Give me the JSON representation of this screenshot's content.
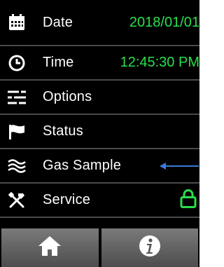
{
  "menu": {
    "date": {
      "label": "Date",
      "value": "2018/01/01",
      "icon": "calendar-icon"
    },
    "time": {
      "label": "Time",
      "value": "12:45:30 PM",
      "icon": "clock-icon"
    },
    "options": {
      "label": "Options",
      "icon": "sliders-icon"
    },
    "status": {
      "label": "Status",
      "icon": "flag-icon"
    },
    "gas_sample": {
      "label": "Gas Sample",
      "icon": "waves-icon"
    },
    "service": {
      "label": "Service",
      "icon": "tools-icon",
      "lock_icon": "lock-icon"
    }
  },
  "footer": {
    "home_icon": "home-icon",
    "info_icon": "info-icon"
  },
  "colors": {
    "value_green": "#28e04a",
    "arrow_blue": "#3b7ad6",
    "background": "#000000",
    "divider": "#4a4a4a"
  }
}
